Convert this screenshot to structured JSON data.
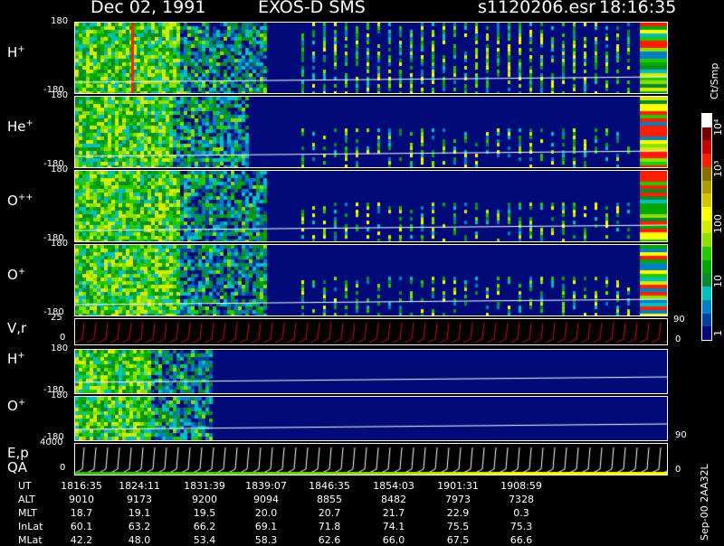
{
  "header": {
    "date": "Dec 02, 1991",
    "instrument": "EXOS-D SMS",
    "file": "s1120206.esr",
    "time": "18:16:35"
  },
  "colorbar": {
    "unit": "Ct/Smp",
    "labels": [
      "10⁴",
      "10³",
      "100",
      "10",
      "1"
    ],
    "colors": [
      "#ffffff",
      "#7a0000",
      "#c80000",
      "#ff1e00",
      "#8a6f00",
      "#b09a00",
      "#d8c200",
      "#ffff00",
      "#d4ec00",
      "#8ce000",
      "#24c800",
      "#00a800",
      "#0a8a2a",
      "#00c0c0",
      "#0080c0",
      "#0040a0",
      "#000a78"
    ]
  },
  "panels": [
    {
      "ion": "H",
      "charge": "+",
      "ymax": "180",
      "ymin": "-180"
    },
    {
      "ion": "He",
      "charge": "+",
      "ymax": "180",
      "ymin": "-180"
    },
    {
      "ion": "O",
      "charge": "++",
      "ymax": "180",
      "ymin": "-180"
    },
    {
      "ion": "O",
      "charge": "+",
      "ymax": "180",
      "ymin": "-180"
    },
    {
      "ion": "V,r",
      "charge": "",
      "ymax": "25",
      "ymin": "0",
      "right_top": "90",
      "right_bottom": "0"
    },
    {
      "ion": "H",
      "charge": "+",
      "ymax": "180",
      "ymin": "-180"
    },
    {
      "ion": "O",
      "charge": "+",
      "ymax": "180",
      "ymin": "-180",
      "right_bottom": "90"
    },
    {
      "ion": "E,p",
      "ion2": "QA",
      "charge": "",
      "ymax": "4000",
      "ymin": "0",
      "right_bottom": "0"
    }
  ],
  "table": {
    "rows": [
      {
        "label": "UT",
        "values": [
          "1816:35",
          "1824:11",
          "1831:39",
          "1839:07",
          "1846:35",
          "1854:03",
          "1901:31",
          "1908:59"
        ]
      },
      {
        "label": "ALT",
        "values": [
          "9010",
          "9173",
          "9200",
          "9094",
          "8855",
          "8482",
          "7973",
          "7328"
        ]
      },
      {
        "label": "MLT",
        "values": [
          "18.7",
          "19.1",
          "19.5",
          "20.0",
          "20.7",
          "21.7",
          "22.9",
          "0.3"
        ]
      },
      {
        "label": "InLat",
        "values": [
          "60.1",
          "63.2",
          "66.2",
          "69.1",
          "71.8",
          "74.1",
          "75.5",
          "75.3"
        ]
      },
      {
        "label": "MLat",
        "values": [
          "42.2",
          "48.0",
          "53.4",
          "58.3",
          "62.6",
          "66.0",
          "67.5",
          "66.6"
        ]
      }
    ]
  },
  "footer": {
    "stamp": "Sep-00 2AA32L"
  },
  "chart_data": {
    "type": "heatmap",
    "title": "Dec 02, 1991   EXOS-D SMS",
    "x_ticks": [
      "1816:35",
      "1824:11",
      "1831:39",
      "1839:07",
      "1846:35",
      "1854:03",
      "1901:31",
      "1908:59"
    ],
    "series": [
      {
        "name": "H+",
        "ylim": [
          -180,
          180
        ]
      },
      {
        "name": "He+",
        "ylim": [
          -180,
          180
        ]
      },
      {
        "name": "O++",
        "ylim": [
          -180,
          180
        ]
      },
      {
        "name": "O+",
        "ylim": [
          -180,
          180
        ]
      },
      {
        "name": "V,r",
        "ylim": [
          0,
          25
        ]
      },
      {
        "name": "H+",
        "ylim": [
          -180,
          180
        ]
      },
      {
        "name": "O+",
        "ylim": [
          -180,
          180
        ]
      },
      {
        "name": "E,p QA",
        "ylim": [
          0,
          4000
        ]
      }
    ],
    "colorbar_unit": "Ct/Smp",
    "colorbar_ticks": [
      "1",
      "10",
      "100",
      "10³",
      "10⁴"
    ]
  }
}
